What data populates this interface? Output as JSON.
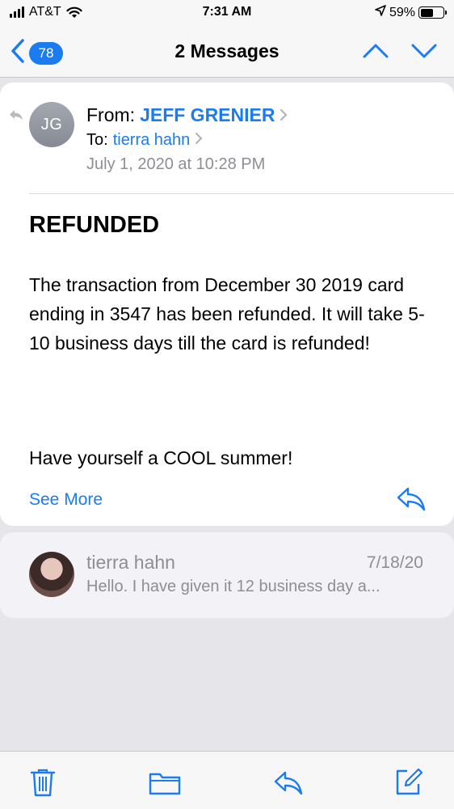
{
  "status_bar": {
    "carrier": "AT&T",
    "time": "7:31 AM",
    "battery": "59%",
    "battery_level": 0.59,
    "icons": [
      "signal-icon",
      "wifi-icon",
      "location-arrow-icon",
      "battery-icon"
    ]
  },
  "nav": {
    "back_badge": "78",
    "title": "2 Messages",
    "icons": [
      "back-chevron-icon",
      "previous-message-icon",
      "next-message-icon"
    ]
  },
  "message": {
    "avatar_initials": "JG",
    "from_label": "From:",
    "from_name": "JEFF GRENIER",
    "to_label": "To:",
    "to_name": "tierra hahn",
    "date": "July 1, 2020 at 10:28 PM",
    "subject": "REFUNDED",
    "body": "The transaction from December 30 2019 card ending in 3547 has been refunded. It will take 5-10 business days till the card is refunded!",
    "signoff": "Have yourself a COOL summer!",
    "see_more": "See More"
  },
  "second_message": {
    "name": "tierra hahn",
    "date": "7/18/20",
    "preview": "Hello. I have given it 12 business day a..."
  },
  "toolbar": {
    "icons": [
      "trash-icon",
      "folder-icon",
      "reply-icon",
      "compose-icon"
    ]
  },
  "colors": {
    "accent": "#1a7cf0",
    "secondary_text": "#8e8e93",
    "background": "#e5e5ea"
  }
}
